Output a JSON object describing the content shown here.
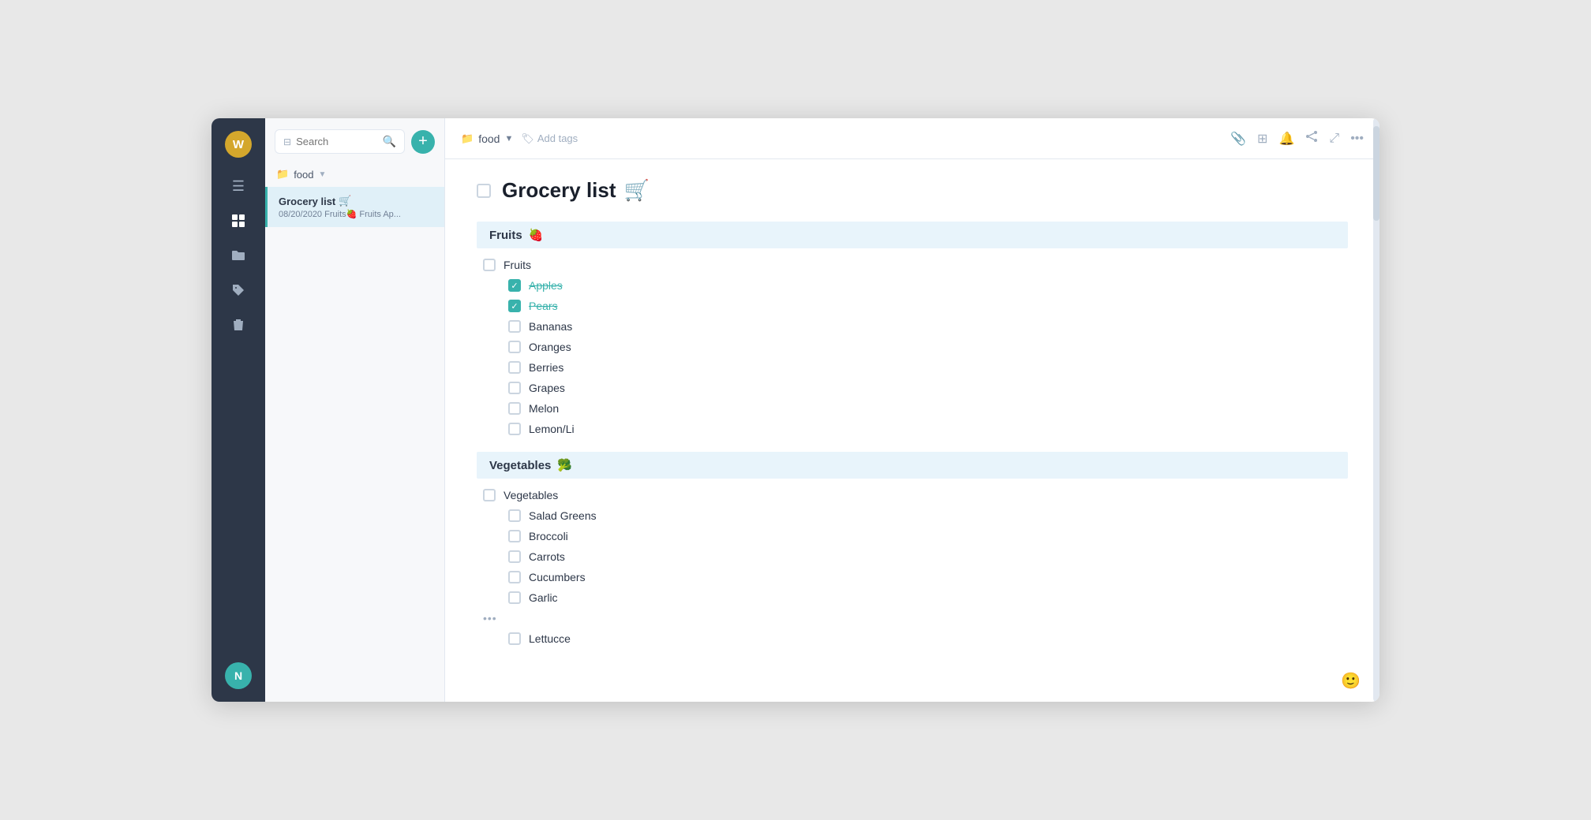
{
  "window": {
    "title": "Grocery list"
  },
  "iconBar": {
    "avatar": "W",
    "avatarBottom": "N",
    "icons": [
      {
        "name": "menu-icon",
        "symbol": "≡"
      },
      {
        "name": "grid-icon",
        "symbol": "⊞"
      },
      {
        "name": "folder-icon",
        "symbol": "📁"
      },
      {
        "name": "tag-icon",
        "symbol": "🏷"
      },
      {
        "name": "trash-icon",
        "symbol": "🗑"
      }
    ]
  },
  "sidebar": {
    "searchPlaceholder": "Search",
    "folderName": "food",
    "addButtonLabel": "+",
    "item": {
      "title": "Grocery list",
      "emoji": "🛒",
      "date": "08/20/2020",
      "tags": "Fruits🍓 Fruits Ap..."
    }
  },
  "topbar": {
    "folderIcon": "📁",
    "folderName": "food",
    "addTagsLabel": "Add tags",
    "tagIcon": "🏷"
  },
  "page": {
    "title": "Grocery list",
    "emoji": "🛒",
    "sections": [
      {
        "name": "Fruits",
        "emoji": "🍓",
        "parentLabel": "Fruits",
        "parentChecked": false,
        "items": [
          {
            "label": "Apples",
            "checked": true
          },
          {
            "label": "Pears",
            "checked": true
          },
          {
            "label": "Bananas",
            "checked": false
          },
          {
            "label": "Oranges",
            "checked": false
          },
          {
            "label": "Berries",
            "checked": false
          },
          {
            "label": "Grapes",
            "checked": false
          },
          {
            "label": "Melon",
            "checked": false
          },
          {
            "label": "Lemon/Li",
            "checked": false
          }
        ]
      },
      {
        "name": "Vegetables",
        "emoji": "🥦",
        "parentLabel": "Vegetables",
        "parentChecked": false,
        "items": [
          {
            "label": "Salad Greens",
            "checked": false
          },
          {
            "label": "Broccoli",
            "checked": false
          },
          {
            "label": "Carrots",
            "checked": false
          },
          {
            "label": "Cucumbers",
            "checked": false
          },
          {
            "label": "Garlic",
            "checked": false
          },
          {
            "label": "Lettucce",
            "checked": false
          }
        ]
      }
    ]
  }
}
